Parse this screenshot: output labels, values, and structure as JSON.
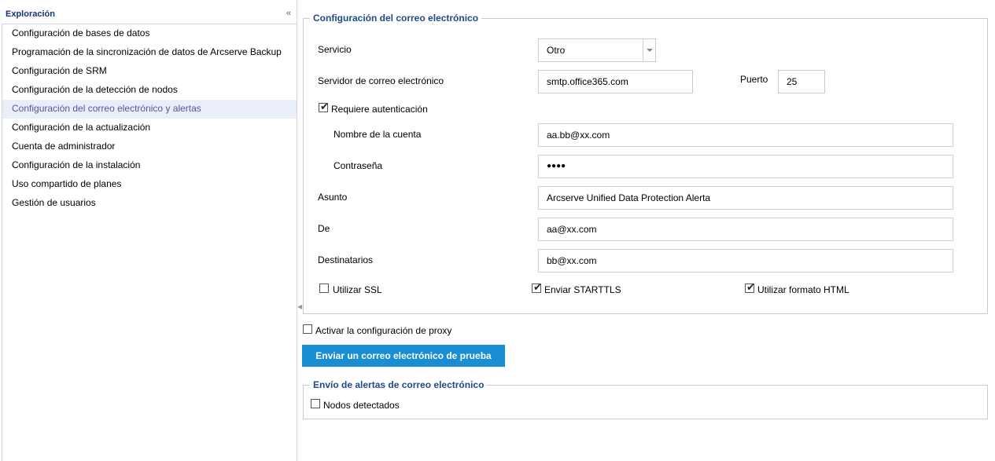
{
  "sidebar": {
    "title": "Exploración",
    "collapse_icon": "double-chevron-left-icon",
    "items": [
      {
        "label": "Configuración de bases de datos",
        "active": false
      },
      {
        "label": "Programación de la sincronización de datos de Arcserve Backup",
        "active": false
      },
      {
        "label": "Configuración de SRM",
        "active": false
      },
      {
        "label": "Configuración de la detección de nodos",
        "active": false
      },
      {
        "label": "Configuración del correo electrónico y alertas",
        "active": true
      },
      {
        "label": "Configuración de la actualización",
        "active": false
      },
      {
        "label": "Cuenta de administrador",
        "active": false
      },
      {
        "label": "Configuración de la instalación",
        "active": false
      },
      {
        "label": "Uso compartido de planes",
        "active": false
      },
      {
        "label": "Gestión de usuarios",
        "active": false
      }
    ]
  },
  "email_config": {
    "legend": "Configuración del correo electrónico",
    "service_label": "Servicio",
    "service_value": "Otro",
    "server_label": "Servidor de correo electrónico",
    "server_value": "smtp.office365.com",
    "port_label": "Puerto",
    "port_value": "25",
    "requires_auth_label": "Requiere autenticación",
    "requires_auth_checked": true,
    "account_label": "Nombre de la cuenta",
    "account_value": "aa.bb@xx.com",
    "password_label": "Contraseña",
    "password_value": "●●●●",
    "subject_label": "Asunto",
    "subject_value": "Arcserve Unified Data Protection Alerta",
    "from_label": "De",
    "from_value": "aa@xx.com",
    "recipients_label": "Destinatarios",
    "recipients_value": "bb@xx.com",
    "use_ssl_label": "Utilizar SSL",
    "use_ssl_checked": false,
    "starttls_label": "Enviar STARTTLS",
    "starttls_checked": true,
    "html_format_label": "Utilizar formato HTML",
    "html_format_checked": true
  },
  "proxy": {
    "label": "Activar la configuración de proxy",
    "checked": false
  },
  "test_email_button": "Enviar un correo electrónico de prueba",
  "alerts": {
    "legend": "Envío de alertas de correo electrónico",
    "discovered_nodes_label": "Nodos detectados",
    "discovered_nodes_checked": false
  },
  "colors": {
    "accent": "#1a8ed2",
    "legend_text": "#1f4a8a",
    "active_item_bg": "#eaeef8",
    "active_item_text": "#4b5a9e"
  }
}
